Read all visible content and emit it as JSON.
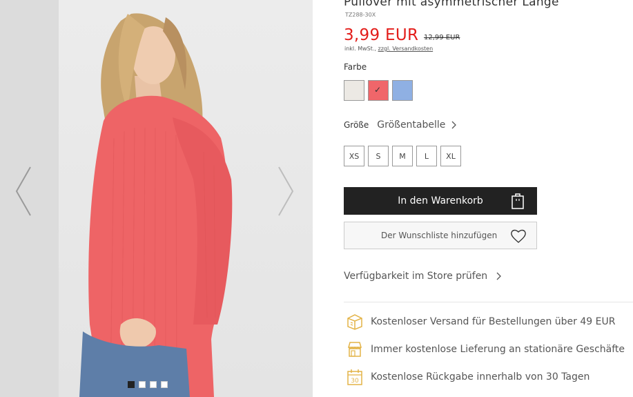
{
  "product": {
    "title": "Pullover mit asymmetrischer Länge",
    "sku": "TZ288-30X",
    "price": "3,99 EUR",
    "old_price": "12,99 EUR",
    "vat_text": "inkl. MwSt.,",
    "shipping_link": "zzgl. Versandkosten"
  },
  "colors": {
    "label": "Farbe",
    "swatches": [
      {
        "name": "white",
        "hex": "#ece9e4"
      },
      {
        "name": "coral",
        "hex": "#f0666a",
        "selected": true
      },
      {
        "name": "light-blue",
        "hex": "#8fb0e3"
      }
    ]
  },
  "sizes": {
    "label": "Größe",
    "size_table": "Größentabelle",
    "options": [
      "XS",
      "S",
      "M",
      "L",
      "XL"
    ]
  },
  "actions": {
    "add_to_cart": "In den Warenkorb",
    "add_to_wishlist": "Der Wunschliste hinzufügen",
    "availability": "Verfügbarkeit im Store prüfen"
  },
  "benefits": [
    {
      "icon": "shipping-box-icon",
      "text": "Kostenloser Versand für Bestellungen über 49 EUR"
    },
    {
      "icon": "store-icon",
      "text": "Immer kostenlose Lieferung an stationäre Geschäfte"
    },
    {
      "icon": "calendar-30-icon",
      "text": "Kostenlose Rückgabe innerhalb von 30 Tagen",
      "badge": "30"
    }
  ],
  "gallery": {
    "image_count": 4,
    "active_index": 0
  },
  "colors_theme": {
    "price_red": "#e31d1a",
    "button_dark": "#222222",
    "benefit_icon": "#e3b347",
    "sweater": "#ee6466"
  }
}
